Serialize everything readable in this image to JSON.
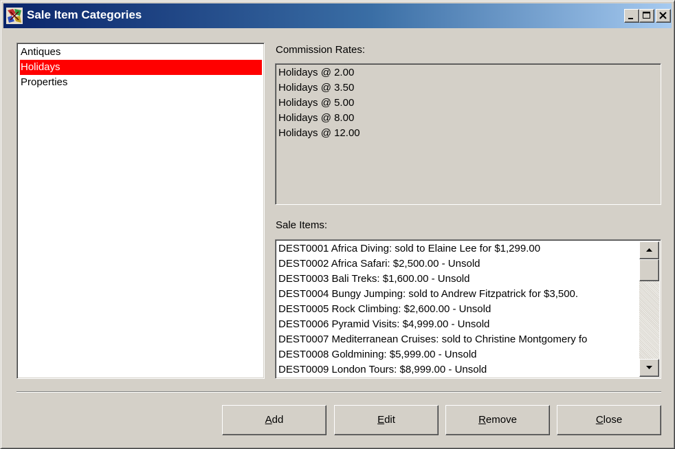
{
  "window": {
    "title": "Sale Item Categories",
    "icon": "app-puzzle-icon",
    "controls": [
      "minimize-icon",
      "maximize-icon",
      "close-icon"
    ]
  },
  "categories": {
    "items": [
      {
        "label": "Antiques",
        "selected": false
      },
      {
        "label": "Holidays",
        "selected": true
      },
      {
        "label": "Properties",
        "selected": false
      }
    ],
    "selected_color": "#ff0000"
  },
  "commission": {
    "label": "Commission Rates:",
    "rates": [
      "Holidays @ 2.00",
      "Holidays @ 3.50",
      "Holidays @ 5.00",
      "Holidays @ 8.00",
      "Holidays @ 12.00"
    ]
  },
  "sale_items": {
    "label": "Sale Items:",
    "rows": [
      "DEST0001 Africa Diving: sold to Elaine Lee for $1,299.00",
      "DEST0002 Africa Safari: $2,500.00 - Unsold",
      "DEST0003 Bali Treks: $1,600.00 - Unsold",
      "DEST0004 Bungy Jumping: sold to Andrew  Fitzpatrick for $3,500.",
      "DEST0005 Rock Climbing: $2,600.00 - Unsold",
      "DEST0006 Pyramid Visits: $4,999.00 - Unsold",
      "DEST0007 Mediterranean Cruises: sold to Christine Montgomery fo",
      "DEST0008 Goldmining: $5,999.00 - Unsold",
      "DEST0009 London Tours: $8,999.00 - Unsold"
    ]
  },
  "buttons": {
    "add": {
      "accel": "A",
      "rest": "dd"
    },
    "edit": {
      "accel": "E",
      "rest": "dit"
    },
    "remove": {
      "accel": "R",
      "rest": "emove"
    },
    "close": {
      "accel": "C",
      "rest": "lose"
    }
  },
  "colors": {
    "face": "#d4d0c8",
    "title_start": "#0a246a",
    "title_end": "#a6caf0"
  }
}
